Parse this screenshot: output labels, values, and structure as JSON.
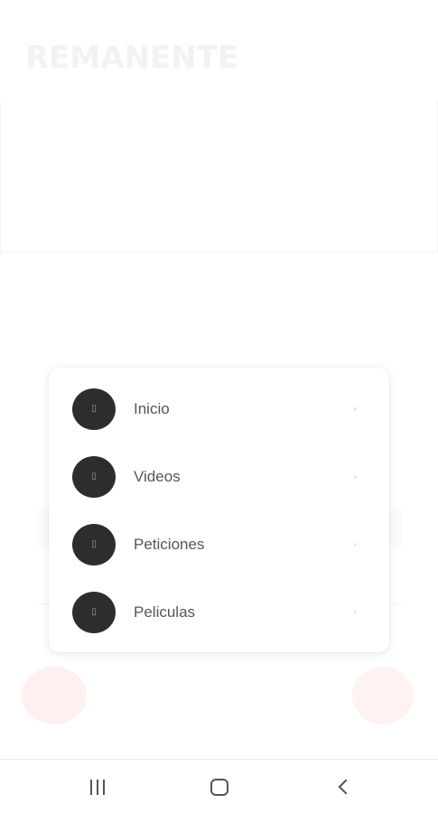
{
  "app": {
    "title": "REMANENTE"
  },
  "menu": {
    "items": [
      {
        "label": "Inicio",
        "icon": "circle-dark-icon"
      },
      {
        "label": "Videos",
        "icon": "circle-dark-icon"
      },
      {
        "label": "Peticiones",
        "icon": "circle-dark-icon"
      },
      {
        "label": "Peliculas",
        "icon": "circle-dark-icon"
      }
    ],
    "icon_glyph": "▯",
    "chevron_glyph": "›"
  },
  "navbar": {
    "recents_icon": "recents-icon",
    "home_icon": "home-icon",
    "back_icon": "back-icon"
  },
  "colors": {
    "icon_bg": "#2d2d2d",
    "fab_tint": "#fff0f0"
  }
}
